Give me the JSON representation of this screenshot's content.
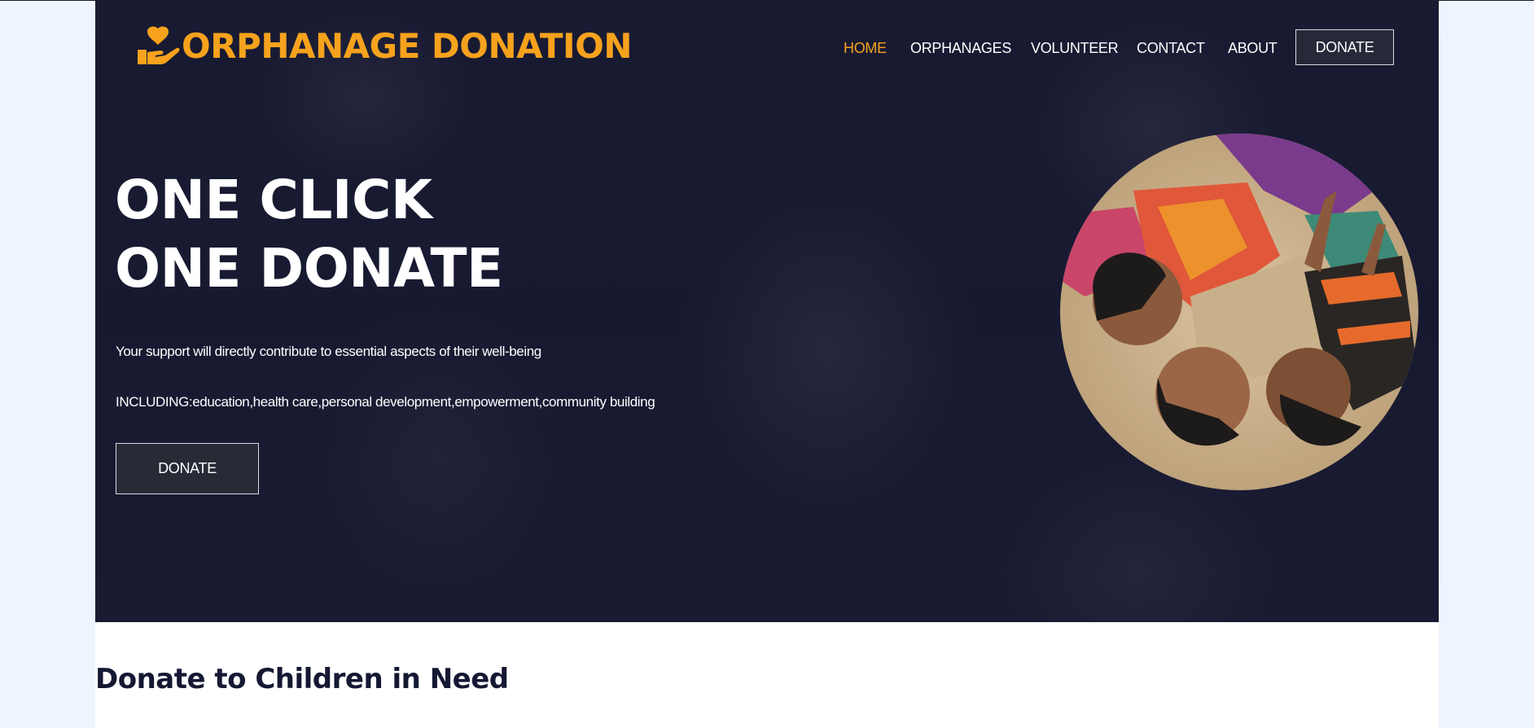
{
  "brand": {
    "name": "ORPHANAGE DONATION",
    "accent_color": "#f6a21d",
    "logo_icon": "hand-heart-icon"
  },
  "nav": {
    "items": [
      {
        "label": "HOME",
        "active": true
      },
      {
        "label": "ORPHANAGES",
        "active": false
      },
      {
        "label": "VOLUNTEER",
        "active": false
      },
      {
        "label": "CONTACT",
        "active": false
      },
      {
        "label": "ABOUT",
        "active": false
      }
    ],
    "donate_label": "DONATE"
  },
  "hero": {
    "headline_line1": "ONE CLICK",
    "headline_line2": "ONE DONATE",
    "subtext1": "Your support will directly contribute to essential aspects of their well-being",
    "subtext2": "INCLUDING:education,health care,personal development,empowerment,community building",
    "donate_label": "DONATE",
    "background_color": "#1d1f37"
  },
  "section": {
    "title": "Donate to Children in Need"
  }
}
